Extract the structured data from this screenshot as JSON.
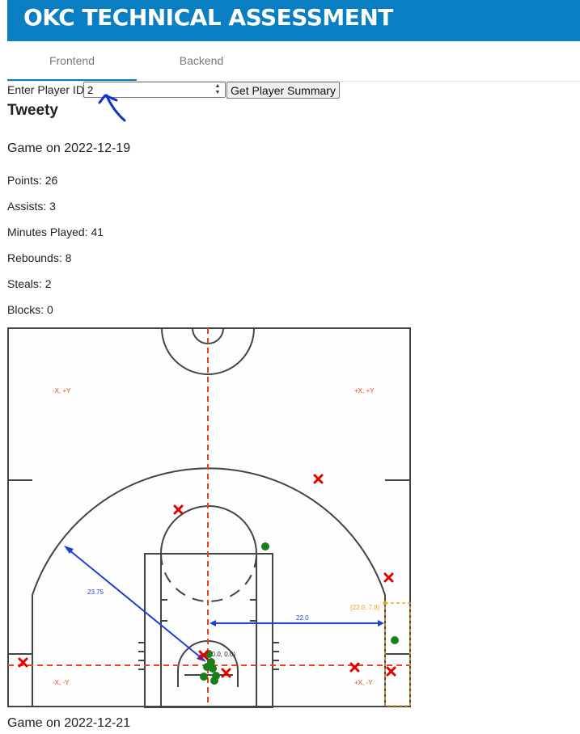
{
  "app": {
    "title": "OKC TECHNICAL ASSESSMENT"
  },
  "tabs": [
    {
      "label": "Frontend",
      "active": true
    },
    {
      "label": "Backend",
      "active": false
    }
  ],
  "form": {
    "label": "Enter Player ID:",
    "value": "2",
    "button_label": "Get Player Summary"
  },
  "player": {
    "name": "Tweety",
    "games": [
      {
        "title": "Game on 2022-12-19",
        "stats": [
          "Points: 26",
          "Assists: 3",
          "Minutes Played: 41",
          "Rebounds: 8",
          "Steals: 2",
          "Blocks: 0"
        ]
      },
      {
        "title": "Game on 2022-12-21"
      }
    ]
  },
  "court": {
    "quadrant_labels": {
      "top_left": "-X, +Y",
      "top_right": "+X, +Y",
      "bottom_left": "-X, -Y",
      "bottom_right": "+X, -Y"
    },
    "origin_label": "(0.0, 0.0)",
    "corner_point_label": "(22.0, 7.8)",
    "arc_distance_label": "23.75",
    "corner_distance_label": "22.0",
    "colors": {
      "made": "#1a7f1a",
      "missed": "#e00000",
      "axis": "#e8431b",
      "measure": "#1c3fd6",
      "corner": "#f0a020",
      "line": "#444444"
    }
  },
  "icons": {
    "made_shot": "green-dot",
    "missed_shot": "red-x",
    "annotation": "hand-drawn-arrow"
  }
}
